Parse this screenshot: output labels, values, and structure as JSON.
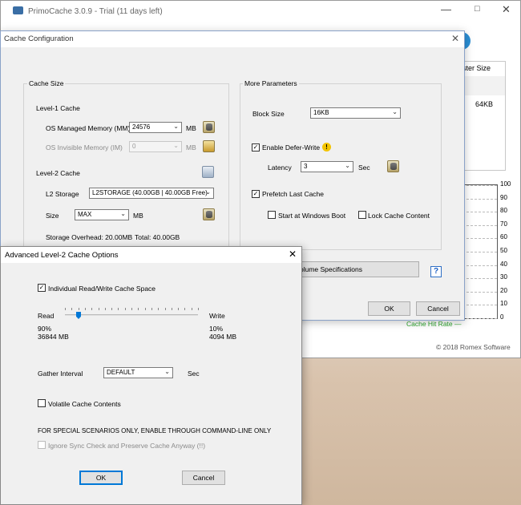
{
  "main_window": {
    "title": "PrimoCache 3.0.9 - Trial (11 days left)",
    "stats_header": "ster Size",
    "stats_value": "64KB",
    "graph_ticks": [
      "100",
      "90",
      "80",
      "70",
      "60",
      "50",
      "40",
      "30",
      "20",
      "10",
      "0"
    ],
    "legend": "Cache Hit Rate",
    "copyright": "© 2018 Romex Software"
  },
  "cache_config": {
    "title": "Cache Configuration",
    "cache_size_group": "Cache Size",
    "level1_label": "Level-1 Cache",
    "os_managed_label": "OS Managed Memory (MM)",
    "os_managed_value": "24576",
    "os_managed_unit": "MB",
    "os_invisible_label": "OS Invisible Memory (IM)",
    "os_invisible_value": "0",
    "os_invisible_unit": "MB",
    "level2_label": "Level-2 Cache",
    "l2_storage_label": "L2 Storage",
    "l2_storage_value": "L2STORAGE (40.00GB | 40.00GB Free)",
    "size_label": "Size",
    "size_value": "MAX",
    "size_unit": "MB",
    "storage_overhead": "Storage Overhead: 20.00MB",
    "total": "Total: 40.00GB",
    "more_params_group": "More Parameters",
    "block_size_label": "Block Size",
    "block_size_value": "16KB",
    "defer_write_label": "Enable Defer-Write",
    "latency_label": "Latency",
    "latency_value": "3",
    "latency_unit": "Sec",
    "prefetch_label": "Prefetch Last Cache",
    "start_windows_label": "Start at Windows Boot",
    "lock_cache_label": "Lock Cache Content",
    "volume_spec_label": "olume Specifications",
    "ok_label": "OK",
    "cancel_label": "Cancel"
  },
  "advanced": {
    "title": "Advanced Level-2 Cache Options",
    "individual_label": "Individual Read/Write Cache Space",
    "read_label": "Read",
    "write_label": "Write",
    "read_percent": "90%",
    "read_mb": "36844 MB",
    "write_percent": "10%",
    "write_mb": "4094 MB",
    "slider_read_fraction": 0.1,
    "gather_label": "Gather Interval",
    "gather_value": "DEFAULT",
    "gather_unit": "Sec",
    "volatile_label": "Volatile Cache Contents",
    "special_note": "FOR SPECIAL SCENARIOS ONLY, ENABLE THROUGH COMMAND-LINE ONLY",
    "ignore_label": "Ignore Sync Check and Preserve Cache Anyway (!!)",
    "ok_label": "OK",
    "cancel_label": "Cancel"
  }
}
